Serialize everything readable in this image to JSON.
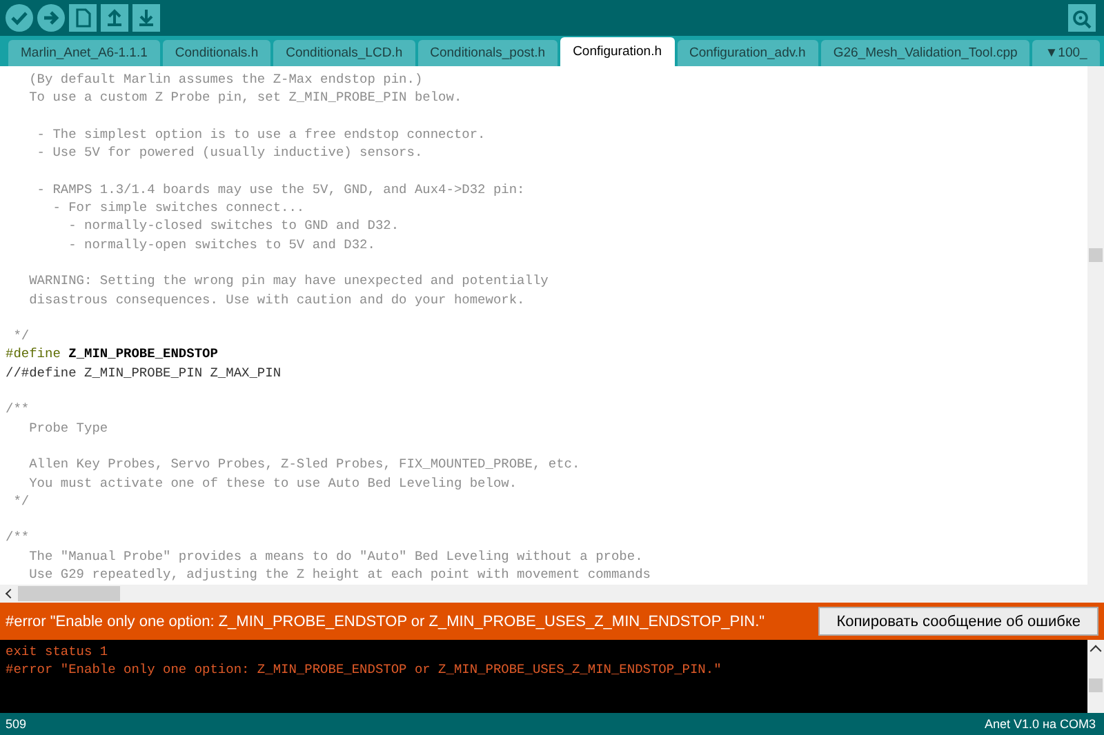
{
  "toolbar": {
    "buttons": [
      {
        "kind": "verify"
      },
      {
        "kind": "upload"
      },
      {
        "kind": "new"
      },
      {
        "kind": "open"
      },
      {
        "kind": "save"
      }
    ]
  },
  "tabs": [
    {
      "label": "Marlin_Anet_A6-1.1.1",
      "selected": false
    },
    {
      "label": "Conditionals.h",
      "selected": false
    },
    {
      "label": "Conditionals_LCD.h",
      "selected": false
    },
    {
      "label": "Conditionals_post.h",
      "selected": false
    },
    {
      "label": "Configuration.h",
      "selected": true
    },
    {
      "label": "Configuration_adv.h",
      "selected": false
    },
    {
      "label": "G26_Mesh_Validation_Tool.cpp",
      "selected": false
    },
    {
      "label": "▼100_",
      "selected": false
    }
  ],
  "editor": {
    "lines": [
      {
        "kind": "comment",
        "text": "   (By default Marlin assumes the Z-Max endstop pin.)"
      },
      {
        "kind": "comment",
        "text": "   To use a custom Z Probe pin, set Z_MIN_PROBE_PIN below."
      },
      {
        "kind": "blank"
      },
      {
        "kind": "comment",
        "text": "    - The simplest option is to use a free endstop connector."
      },
      {
        "kind": "comment",
        "text": "    - Use 5V for powered (usually inductive) sensors."
      },
      {
        "kind": "blank"
      },
      {
        "kind": "comment",
        "text": "    - RAMPS 1.3/1.4 boards may use the 5V, GND, and Aux4->D32 pin:"
      },
      {
        "kind": "comment",
        "text": "      - For simple switches connect..."
      },
      {
        "kind": "comment",
        "text": "        - normally-closed switches to GND and D32."
      },
      {
        "kind": "comment",
        "text": "        - normally-open switches to 5V and D32."
      },
      {
        "kind": "blank"
      },
      {
        "kind": "comment",
        "text": "   WARNING: Setting the wrong pin may have unexpected and potentially"
      },
      {
        "kind": "comment",
        "text": "   disastrous consequences. Use with caution and do your homework."
      },
      {
        "kind": "blank"
      },
      {
        "kind": "comment",
        "text": " */"
      },
      {
        "kind": "define",
        "keyword": "#define",
        "text": " Z_MIN_PROBE_ENDSTOP"
      },
      {
        "kind": "code",
        "text": "//#define Z_MIN_PROBE_PIN Z_MAX_PIN"
      },
      {
        "kind": "blank"
      },
      {
        "kind": "comment",
        "text": "/**"
      },
      {
        "kind": "comment",
        "text": "   Probe Type"
      },
      {
        "kind": "blank"
      },
      {
        "kind": "comment",
        "text": "   Allen Key Probes, Servo Probes, Z-Sled Probes, FIX_MOUNTED_PROBE, etc."
      },
      {
        "kind": "comment",
        "text": "   You must activate one of these to use Auto Bed Leveling below."
      },
      {
        "kind": "comment",
        "text": " */"
      },
      {
        "kind": "blank"
      },
      {
        "kind": "comment",
        "text": "/**"
      },
      {
        "kind": "comment",
        "text": "   The \"Manual Probe\" provides a means to do \"Auto\" Bed Leveling without a probe."
      },
      {
        "kind": "comment",
        "text": "   Use G29 repeatedly, adjusting the Z height at each point with movement commands"
      }
    ]
  },
  "error_bar": {
    "message": "#error \"Enable only one option: Z_MIN_PROBE_ENDSTOP or Z_MIN_PROBE_USES_Z_MIN_ENDSTOP_PIN.\"",
    "button": "Копировать сообщение об ошибке"
  },
  "console": {
    "lines": [
      "exit status 1",
      "#error \"Enable only one option: Z_MIN_PROBE_ENDSTOP or Z_MIN_PROBE_USES_Z_MIN_ENDSTOP_PIN.\""
    ]
  },
  "status_bar": {
    "line_number": "509",
    "board": "Anet V1.0 на COM3"
  }
}
